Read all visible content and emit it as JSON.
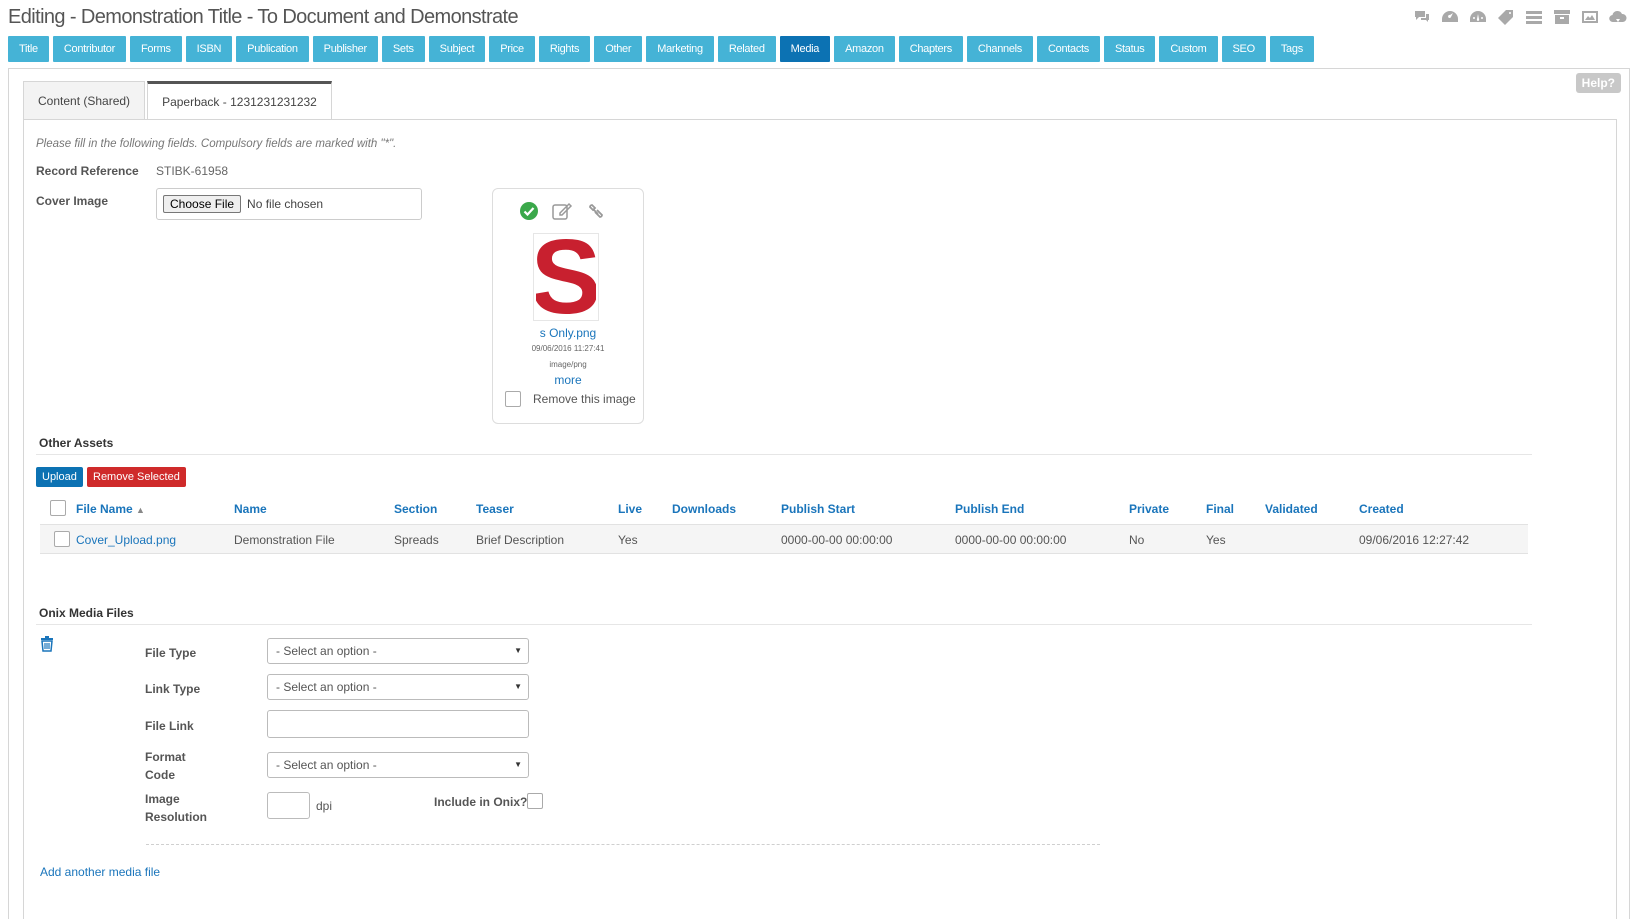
{
  "page": {
    "title": "Editing - Demonstration Title - To Document and Demonstrate"
  },
  "top_icons": [
    "chat-icon",
    "dashboard-icon",
    "gauge-icon",
    "tag-icon",
    "list-icon",
    "archive-icon",
    "image-icon",
    "cloud-download-icon"
  ],
  "nav": {
    "items": [
      "Title",
      "Contributor",
      "Forms",
      "ISBN",
      "Publication",
      "Publisher",
      "Sets",
      "Subject",
      "Price",
      "Rights",
      "Other",
      "Marketing",
      "Related",
      "Media",
      "Amazon",
      "Chapters",
      "Channels",
      "Contacts",
      "Status",
      "Custom",
      "SEO",
      "Tags"
    ],
    "active": "Media"
  },
  "help": "Help?",
  "tabs": {
    "shared": "Content (Shared)",
    "paperback": "Paperback - 1231231231232"
  },
  "form": {
    "hint": "Please fill in the following fields. Compulsory fields are marked with \"*\".",
    "record_ref_label": "Record Reference",
    "record_ref_value": "STIBK-61958",
    "cover_label": "Cover Image",
    "choose_file": "Choose File",
    "no_file": "No file chosen"
  },
  "cover_card": {
    "file_name": "s Only.png",
    "date": "09/06/2016 11:27:41",
    "mime": "image/png",
    "more": "more",
    "remove_label": "Remove this image",
    "logo_letter": "S",
    "logo_color": "#c8202f"
  },
  "other_assets": {
    "title": "Other Assets",
    "upload": "Upload",
    "remove_selected": "Remove Selected",
    "sort_marker": "▲",
    "headers": {
      "file_name": "File Name",
      "name": "Name",
      "section": "Section",
      "teaser": "Teaser",
      "live": "Live",
      "downloads": "Downloads",
      "publish_start": "Publish Start",
      "publish_end": "Publish End",
      "private": "Private",
      "final": "Final",
      "validated": "Validated",
      "created": "Created"
    },
    "rows": [
      {
        "file_name": "Cover_Upload.png",
        "name": "Demonstration File",
        "section": "Spreads",
        "teaser": "Brief Description",
        "live": "Yes",
        "downloads": "",
        "publish_start": "0000-00-00 00:00:00",
        "publish_end": "0000-00-00 00:00:00",
        "private": "No",
        "final": "Yes",
        "validated": "",
        "created": "09/06/2016 12:27:42"
      }
    ]
  },
  "onix": {
    "title": "Onix Media Files",
    "file_type_label": "File Type",
    "link_type_label": "Link Type",
    "file_link_label": "File Link",
    "format_code_label_1": "Format",
    "format_code_label_2": "Code",
    "image_res_label_1": "Image",
    "image_res_label_2": "Resolution",
    "select_placeholder": "- Select an option -",
    "dpi": "dpi",
    "include_label": "Include in Onix?",
    "add_link": "Add another media file"
  },
  "colors": {
    "nav": "#45b3d6",
    "nav_active": "#0c72b3",
    "link": "#1a75bb",
    "danger": "#cf2a2a"
  }
}
